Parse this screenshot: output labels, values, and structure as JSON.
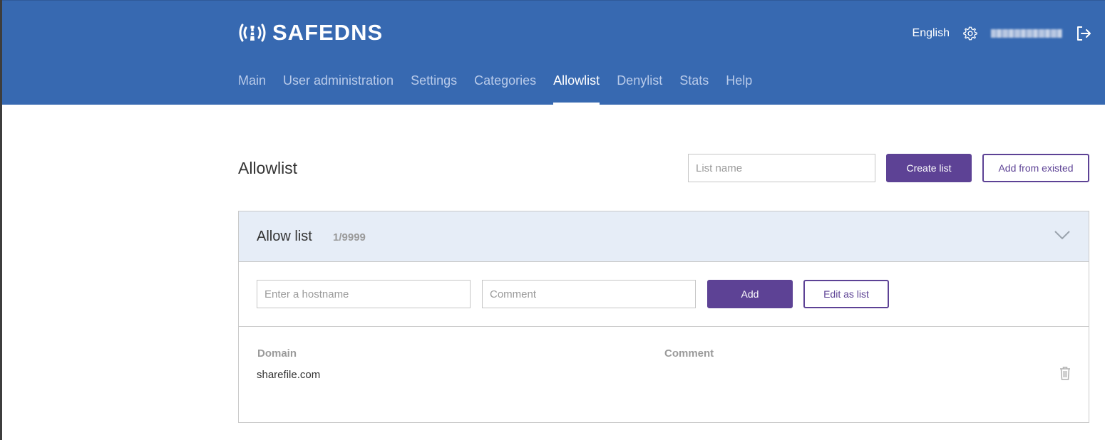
{
  "app": {
    "brand": "SAFEDNS"
  },
  "header": {
    "language": "English",
    "user": "",
    "nav": [
      {
        "label": "Main"
      },
      {
        "label": "User administration"
      },
      {
        "label": "Settings"
      },
      {
        "label": "Categories"
      },
      {
        "label": "Allowlist",
        "active": true
      },
      {
        "label": "Denylist"
      },
      {
        "label": "Stats"
      },
      {
        "label": "Help"
      }
    ]
  },
  "page": {
    "title": "Allowlist",
    "list_name_placeholder": "List name",
    "create_list_label": "Create list",
    "add_from_existed_label": "Add from existed"
  },
  "panel": {
    "title": "Allow list",
    "count": "1/9999",
    "hostname_placeholder": "Enter a hostname",
    "comment_placeholder": "Comment",
    "add_label": "Add",
    "edit_as_list_label": "Edit as list",
    "columns": {
      "domain": "Domain",
      "comment": "Comment"
    },
    "rows": [
      {
        "domain": "sharefile.com",
        "comment": ""
      }
    ]
  },
  "colors": {
    "header_bg": "#3769b1",
    "accent_purple": "#5d4295",
    "panel_head_bg": "#e6edf7"
  },
  "icons": [
    "lighthouse-logo-icon",
    "gear-icon",
    "logout-icon",
    "chevron-down-icon",
    "trash-icon"
  ]
}
